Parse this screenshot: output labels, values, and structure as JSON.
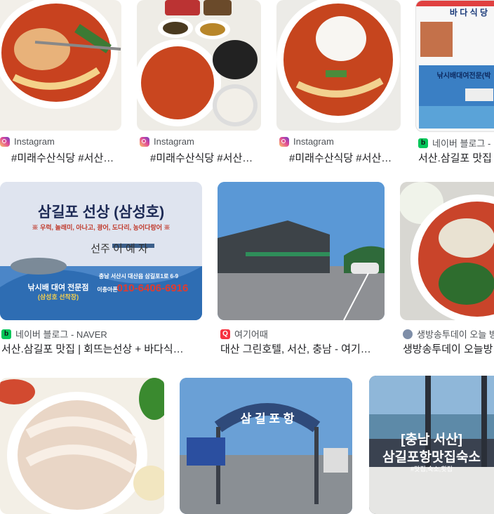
{
  "results": [
    {
      "source": "Instagram",
      "title": "#미래수산식당 #서산…"
    },
    {
      "source": "Instagram",
      "title": "#미래수산식당 #서산…"
    },
    {
      "source": "Instagram",
      "title": "#미래수산식당 #서산…"
    },
    {
      "source": "네이버 블로그 -",
      "title": "서산.삼길포 맛집"
    },
    {
      "source": "네이버 블로그 - NAVER",
      "title": "서산.삼길포 맛집 | 회뜨는선상 + 바다식…"
    },
    {
      "source": "여기어때",
      "title": "대산 그린호텔, 서산, 충남 - 여기…"
    },
    {
      "source": "생방송투데이 오늘 방",
      "title": "생방송투데이 오늘방"
    }
  ],
  "image_text": {
    "sign_title": "삼길포 선상 (삼성호)",
    "sign_sub": "※ 우럭, 놀래미, 아나고, 광어, 도다리, 농어다랑어 ※",
    "sign_name": "선주  이   예   자",
    "sign_addr": "충남 서산시 대산읍 삼길포1로 6-9",
    "sign_phone": "010-6406-6916",
    "sign_phone_label": "이충아폰",
    "sign_tag": "낚시배 대여 전문점",
    "sign_tag2": "(삼성호 선착장)",
    "menu_title": "바 다 식 당",
    "menu_sub": "낚시배대여전문(박",
    "arch_text": "삼 길 포 항",
    "overlay_line1": "[충남 서산]",
    "overlay_line2": "삼길포항맛집숙소",
    "overlay_line3": "#맛집,숙소,횟집"
  },
  "colors": {
    "instagram": "#df4996",
    "naver": "#03c75a",
    "yeogi": "#f7323f"
  }
}
